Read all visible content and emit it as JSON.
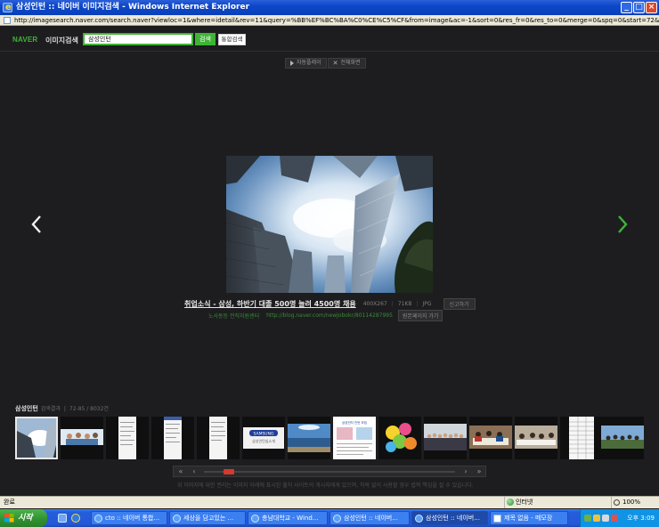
{
  "window": {
    "title": "삼성인턴 :: 네이버 이미지검색 - Windows Internet Explorer",
    "address": "http://imagesearch.naver.com/search.naver?viewloc=1&where=idetail&rev=11&query=%BB%EF%BC%BA%C0%CE%C5%CF&from=image&ac=-1&sort=0&res_fr=0&res_to=0&merge=0&spq=0&start=72&a_q=&n_q=&o_q=&lm"
  },
  "naver": {
    "logo": "NAVER",
    "section": "이미지검색",
    "search_value": "삼성인턴",
    "search_button": "검색",
    "all_search_button": "통합검색"
  },
  "viewer": {
    "autoplay_label": "자동플레이",
    "fullscreen_label": "전체화면",
    "image_title": "취업소식 - 삼성, 하반기 대졸 500명 늘려 4500명 채용",
    "dimensions": "400X267",
    "filesize": "71KB",
    "filetype": "JPG",
    "share_button": "신고하기",
    "source_name": "노사동등 전직지원센터",
    "source_url": "http://blog.naver.com/newjobokr/80114287995",
    "go_original_button": "원본페이지 가기"
  },
  "thumbs": {
    "query": "삼성인턴",
    "label": "검색결과",
    "count": "72-85 / 8032건",
    "samsung_text": "SAMSUNG",
    "samsung_sub": "삼성전자 인턴 모집",
    "item6_caption": "삼성인턴십소개",
    "items": [
      "buildings",
      "people",
      "document",
      "document",
      "document",
      "samsung-banner",
      "landscape",
      "newspaper",
      "balloons",
      "group-photo",
      "meeting",
      "meeting",
      "table-document",
      "crowd"
    ],
    "selected_index": 0
  },
  "pager": {
    "position_fraction": 0.08
  },
  "notice": "위 이미지에 대한 권리는 이미지 아래에 표시된 출처 사이트의 게시자에게 있으며, 허락 없이 사용할 경우 법적 책임을 질 수 있습니다.",
  "statusbar": {
    "status": "완료",
    "zone": "인터넷",
    "zoom": "100%"
  },
  "taskbar": {
    "start_label": "시작",
    "tasks": [
      "cto :: 네이버 통합...",
      "세상을 담고있는 ...",
      "충남대학교 - Wind...",
      "삼성인턴 :: 네이버...",
      "삼성인턴 :: 네이버...",
      "제목 없음 - 메모장"
    ],
    "active_task_index": 4,
    "clock": "오후 3:09"
  },
  "colors": {
    "naver_green": "#3eb437",
    "background": "#1d1d1f",
    "pager_thumb": "#d43a2f"
  }
}
